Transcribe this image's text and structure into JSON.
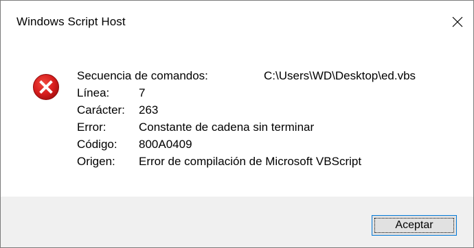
{
  "window": {
    "title": "Windows Script Host",
    "close_icon": "close-x-icon"
  },
  "message": {
    "icon": "error-icon",
    "icon_color": "#e81123",
    "rows": [
      {
        "label": "Secuencia de comandos:",
        "value": "C:\\Users\\WD\\Desktop\\ed.vbs"
      },
      {
        "label": "Línea:",
        "value": "7"
      },
      {
        "label": "Carácter:",
        "value": "263"
      },
      {
        "label": "Error:",
        "value": "Constante de cadena sin terminar"
      },
      {
        "label": "Código:",
        "value": "800A0409"
      },
      {
        "label": "Origen:",
        "value": "Error de compilación de Microsoft VBScript"
      }
    ]
  },
  "footer": {
    "ok_label": "Aceptar"
  },
  "colors": {
    "footer_bg": "#f0f0f0",
    "button_border": "#0078d7",
    "button_bg": "#e1e1e1"
  }
}
